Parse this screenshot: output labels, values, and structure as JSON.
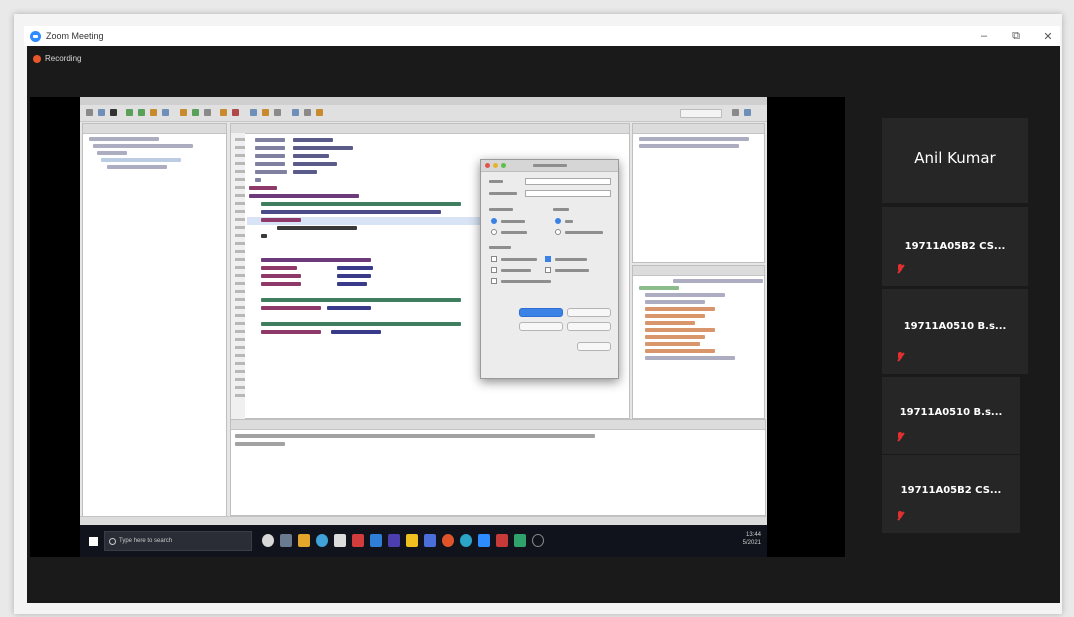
{
  "window": {
    "title": "Zoom Meeting",
    "controls": {
      "minimize": "–",
      "maximize": "⧉",
      "close": "✕"
    }
  },
  "meeting": {
    "recording_label": "Recording"
  },
  "shared_screen": {
    "taskbar": {
      "search_placeholder": "Type here to search",
      "time": "13:44",
      "date": "5/2021"
    }
  },
  "participants": [
    {
      "name": "Anil Kumar",
      "muted": false
    },
    {
      "name": "19711A05B2 CS...",
      "muted": true
    },
    {
      "name": "19711A0510 B.s...",
      "muted": true
    },
    {
      "name": "19711A0510 B.s...",
      "muted": true
    },
    {
      "name": "19711A05B2 CS...",
      "muted": true
    }
  ],
  "colors": {
    "zoom_blue": "#2d8cff",
    "recording_red": "#e8572a",
    "muted_red": "#e0312f",
    "meeting_bg": "#1a1a1a",
    "tile_bg": "#262626"
  }
}
